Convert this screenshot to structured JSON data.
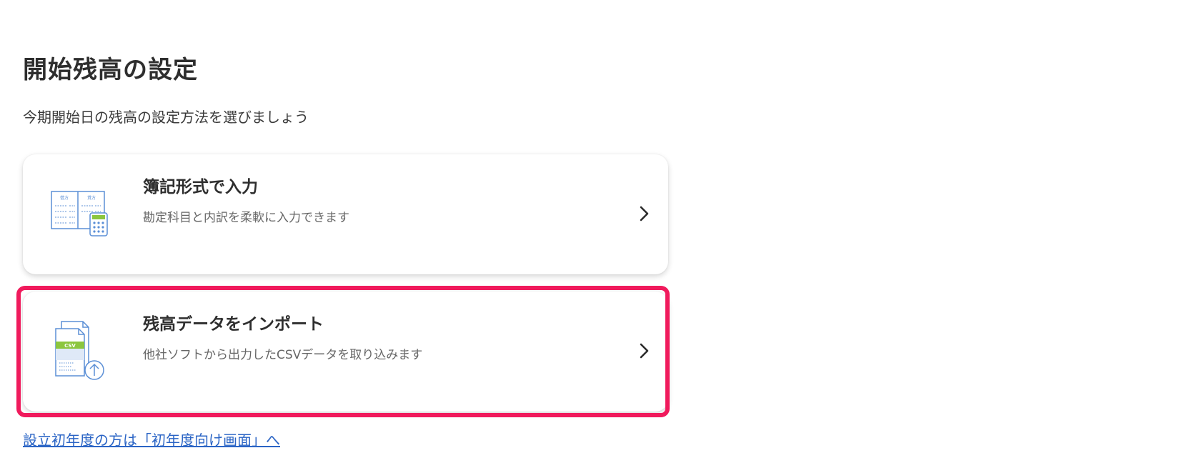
{
  "page": {
    "title": "開始残高の設定",
    "subtitle": "今期開始日の残高の設定方法を選びましょう"
  },
  "options": [
    {
      "title": "簿記形式で入力",
      "description": "勘定科目と内訳を柔軟に入力できます",
      "icon": "ledger-calculator-icon",
      "icon_labels": [
        "借方",
        "貸方"
      ]
    },
    {
      "title": "残高データをインポート",
      "description": "他社ソフトから出力したCSVデータを取り込みます",
      "icon": "csv-upload-icon",
      "icon_labels": [
        "CSV"
      ],
      "highlighted": true
    }
  ],
  "link": {
    "label": "設立初年度の方は「初年度向け画面」へ"
  },
  "colors": {
    "highlight": "#f01a5c",
    "link": "#2a64c5",
    "icon_blue": "#5b8fd6",
    "icon_green": "#8cc63f"
  }
}
